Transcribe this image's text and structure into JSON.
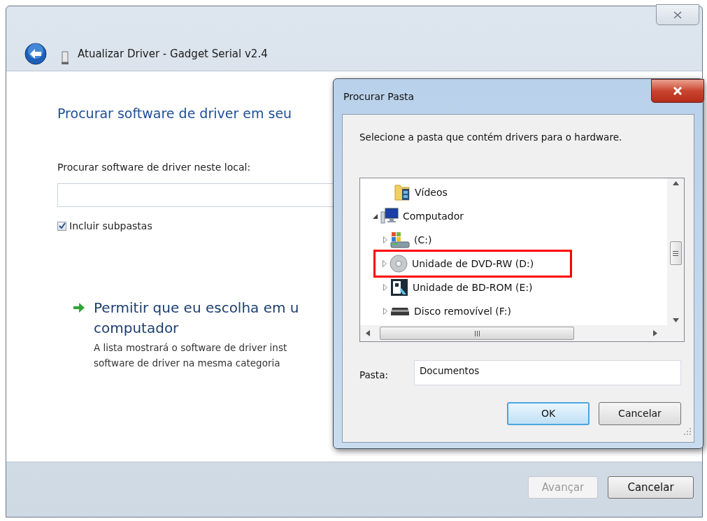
{
  "window": {
    "title": "Atualizar Driver - Gadget Serial v2.4"
  },
  "heading": "Procurar software de driver em seu",
  "location_label": "Procurar software de driver neste local:",
  "include_subfolders": {
    "label": "Incluir subpastas",
    "checked": true
  },
  "option": {
    "title_lines": [
      "Permitir que eu escolha em u",
      "computador"
    ],
    "description_lines": [
      "A lista mostrará o software de driver inst",
      "software de driver na mesma categoria"
    ]
  },
  "buttons": [
    {
      "label": "Avançar",
      "disabled": true
    },
    {
      "label": "Cancelar",
      "disabled": false
    }
  ],
  "dialog": {
    "title": "Procurar Pasta",
    "instruction": "Selecione a pasta que contém drivers para o hardware.",
    "tree": [
      {
        "label": "Vídeos",
        "kind": "video-folder"
      },
      {
        "label": "Computador",
        "kind": "computer",
        "expanded": true,
        "children": [
          {
            "label": "(C:)",
            "kind": "system-drive",
            "expanded": false,
            "highlighted": false
          },
          {
            "label": "Unidade de DVD-RW (D:)",
            "kind": "disc",
            "expanded": false,
            "highlighted": true
          },
          {
            "label": "Unidade de BD-ROM (E:)",
            "kind": "bd-drive",
            "expanded": false,
            "highlighted": false
          },
          {
            "label": "Disco removível (F:)",
            "kind": "removable",
            "expanded": false,
            "highlighted": false
          }
        ]
      }
    ],
    "folder_label": "Pasta:",
    "folder_value": "Documentos",
    "buttons": [
      {
        "label": "OK",
        "default": true
      },
      {
        "label": "Cancelar",
        "default": false
      }
    ]
  }
}
